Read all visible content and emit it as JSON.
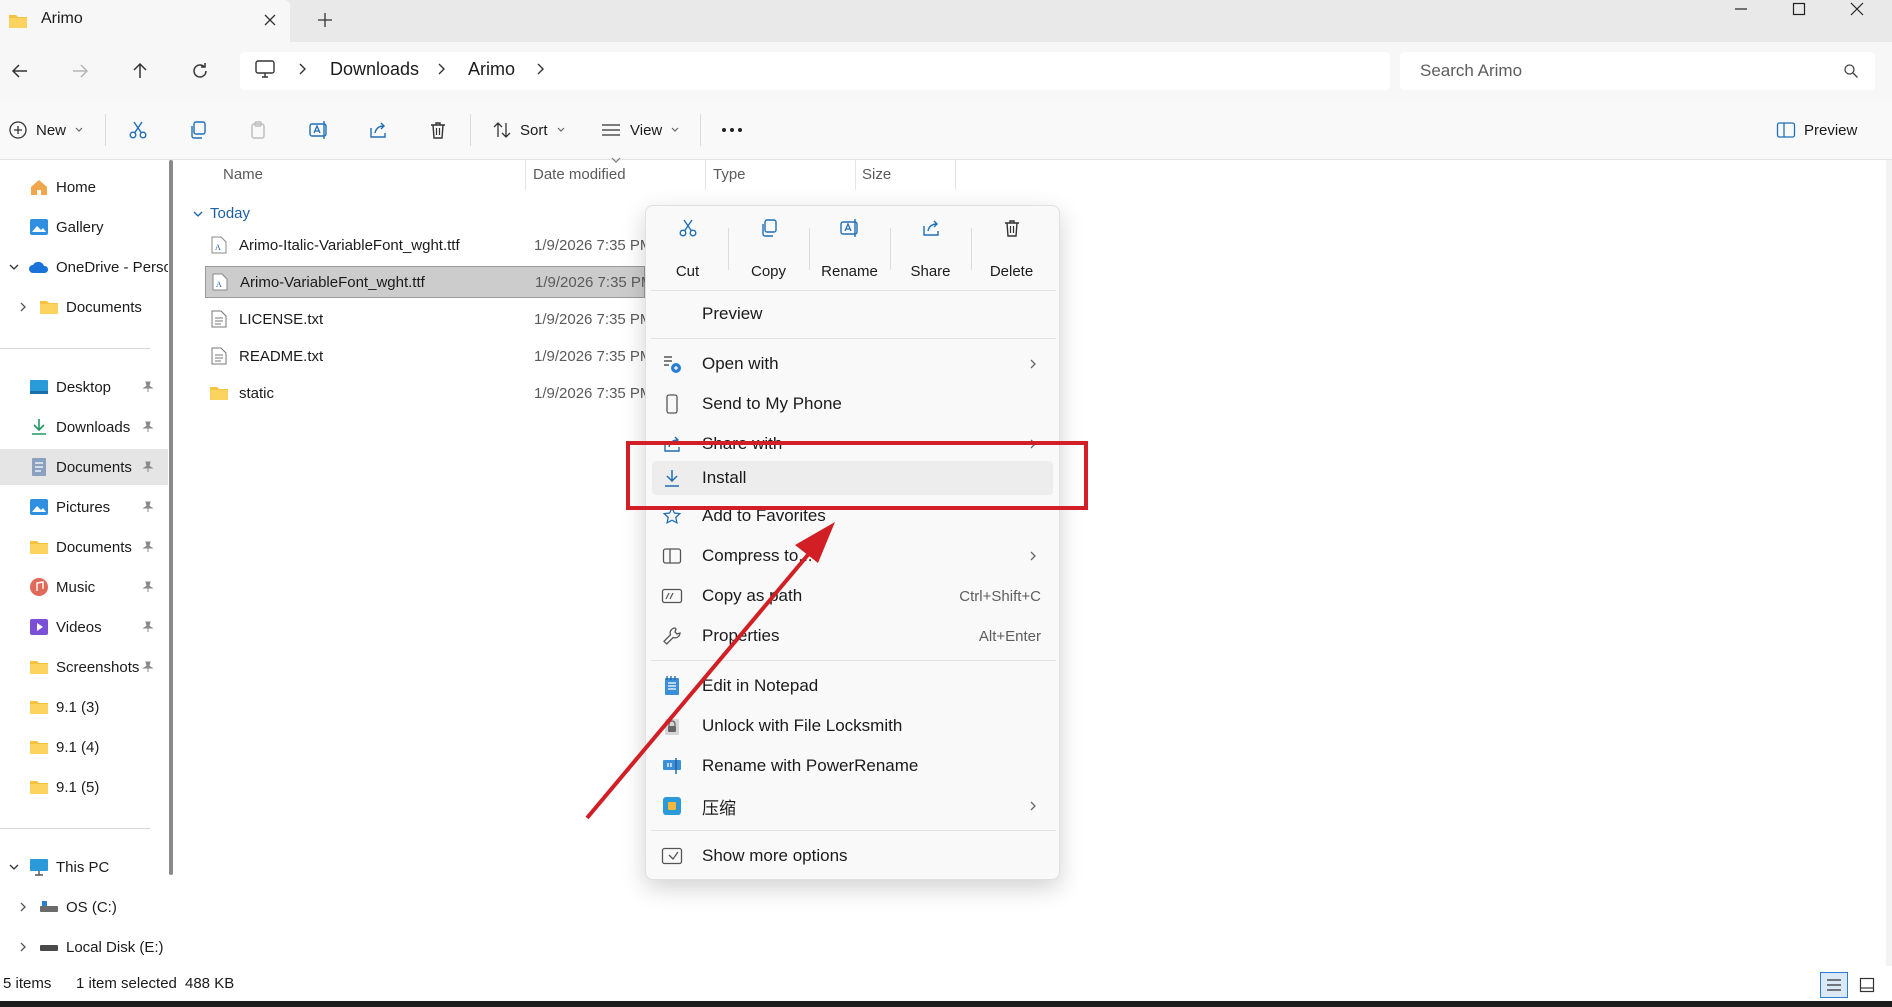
{
  "window": {
    "tab_title": "Arimo",
    "icons": {
      "tab": "folder-icon",
      "close_tab": "close-icon",
      "new_tab": "plus-icon",
      "minimize": "minimize-icon",
      "maximize": "maximize-icon",
      "close_window": "close-icon"
    }
  },
  "nav": {
    "breadcrumb": [
      "Downloads",
      "Arimo"
    ],
    "search_placeholder": "Search Arimo"
  },
  "toolbar": {
    "new_label": "New",
    "sort_label": "Sort",
    "view_label": "View",
    "preview_label": "Preview"
  },
  "sidebar": {
    "top": [
      {
        "label": "Home",
        "icon": "home-icon"
      },
      {
        "label": "Gallery",
        "icon": "gallery-icon"
      },
      {
        "label": "OneDrive - Perso",
        "icon": "cloud-icon"
      },
      {
        "label": "Documents",
        "icon": "folder-icon"
      }
    ],
    "pinned": [
      {
        "label": "Desktop",
        "icon": "desktop-icon"
      },
      {
        "label": "Downloads",
        "icon": "download-icon"
      },
      {
        "label": "Documents",
        "icon": "documents-icon"
      },
      {
        "label": "Pictures",
        "icon": "pictures-icon"
      },
      {
        "label": "Documents",
        "icon": "folder-icon"
      },
      {
        "label": "Music",
        "icon": "music-icon"
      },
      {
        "label": "Videos",
        "icon": "videos-icon"
      },
      {
        "label": "Screenshots",
        "icon": "folder-icon"
      },
      {
        "label": "9.1 (3)",
        "icon": "folder-icon"
      },
      {
        "label": "9.1 (4)",
        "icon": "folder-icon"
      },
      {
        "label": "9.1 (5)",
        "icon": "folder-icon"
      }
    ],
    "devices": [
      {
        "label": "This PC",
        "icon": "pc-icon"
      },
      {
        "label": "OS (C:)",
        "icon": "drive-icon"
      },
      {
        "label": "Local Disk (E:)",
        "icon": "drive-icon"
      }
    ]
  },
  "filelist": {
    "columns": [
      "Name",
      "Date modified",
      "Type",
      "Size"
    ],
    "group": "Today",
    "files": [
      {
        "name": "Arimo-Italic-VariableFont_wght.ttf",
        "date": "1/9/2026 7:35 PM",
        "icon": "font-file-icon"
      },
      {
        "name": "Arimo-VariableFont_wght.ttf",
        "date": "1/9/2026 7:35 PM",
        "icon": "font-file-icon",
        "selected": true
      },
      {
        "name": "LICENSE.txt",
        "date": "1/9/2026 7:35 PM",
        "icon": "text-file-icon"
      },
      {
        "name": "README.txt",
        "date": "1/9/2026 7:35 PM",
        "icon": "text-file-icon"
      },
      {
        "name": "static",
        "date": "1/9/2026 7:35 PM",
        "icon": "folder-icon"
      }
    ]
  },
  "context_menu": {
    "quick_actions": [
      "Cut",
      "Copy",
      "Rename",
      "Share",
      "Delete"
    ],
    "items": {
      "preview": "Preview",
      "open_with": "Open with",
      "send_to_phone": "Send to My Phone",
      "share_with": "Share with",
      "install": "Install",
      "add_favorites": "Add to Favorites",
      "compress": "Compress to...",
      "copy_path": "Copy as path",
      "copy_path_shortcut": "Ctrl+Shift+C",
      "properties": "Properties",
      "properties_shortcut": "Alt+Enter",
      "edit_notepad": "Edit in Notepad",
      "unlock": "Unlock with File Locksmith",
      "power_rename": "Rename with PowerRename",
      "zip": "压缩",
      "more_options": "Show more options"
    }
  },
  "status": {
    "items": "5 items",
    "selected": "1 item selected",
    "size": "488 KB"
  },
  "colors": {
    "annotation": "#d21f26",
    "accent": "#0067c0",
    "selection": "#cccccc"
  }
}
